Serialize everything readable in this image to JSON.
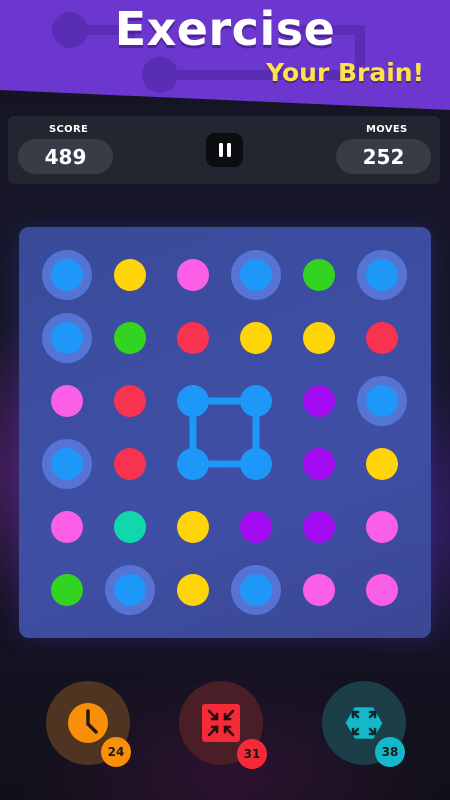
{
  "banner": {
    "title": "Exercise",
    "subtitle": "Your Brain!"
  },
  "stats": {
    "score_label": "SCORE",
    "score_value": "489",
    "moves_label": "MOVES",
    "moves_value": "252"
  },
  "board": {
    "rows": [
      [
        "blue-ring",
        "yellow",
        "pink",
        "blue-ring",
        "green",
        "blue-ring"
      ],
      [
        "blue-ring",
        "green",
        "red",
        "yellow",
        "yellow",
        "red"
      ],
      [
        "pink",
        "red",
        "blue-link",
        "blue-link",
        "purple",
        "blue-ring"
      ],
      [
        "blue-ring",
        "red",
        "blue-link",
        "blue-link",
        "purple",
        "yellow"
      ],
      [
        "pink",
        "teal",
        "yellow",
        "purple",
        "purple",
        "pink"
      ],
      [
        "green",
        "blue-ring",
        "yellow",
        "blue-ring",
        "pink",
        "pink"
      ]
    ],
    "colors": {
      "blue": "#1d97f8",
      "yellow": "#ffd408",
      "pink": "#fb5fe6",
      "green": "#33d41f",
      "red": "#f7334f",
      "purple": "#a30bf0",
      "teal": "#10d8ac"
    }
  },
  "powerups": [
    {
      "name": "timer",
      "icon": "clock-icon",
      "count": "24",
      "color": "#f98e08"
    },
    {
      "name": "shrink",
      "icon": "shrink-arrows-icon",
      "count": "31",
      "color": "#f42a39"
    },
    {
      "name": "expand",
      "icon": "expand-arrows-icon",
      "count": "38",
      "color": "#13b8c9"
    }
  ]
}
